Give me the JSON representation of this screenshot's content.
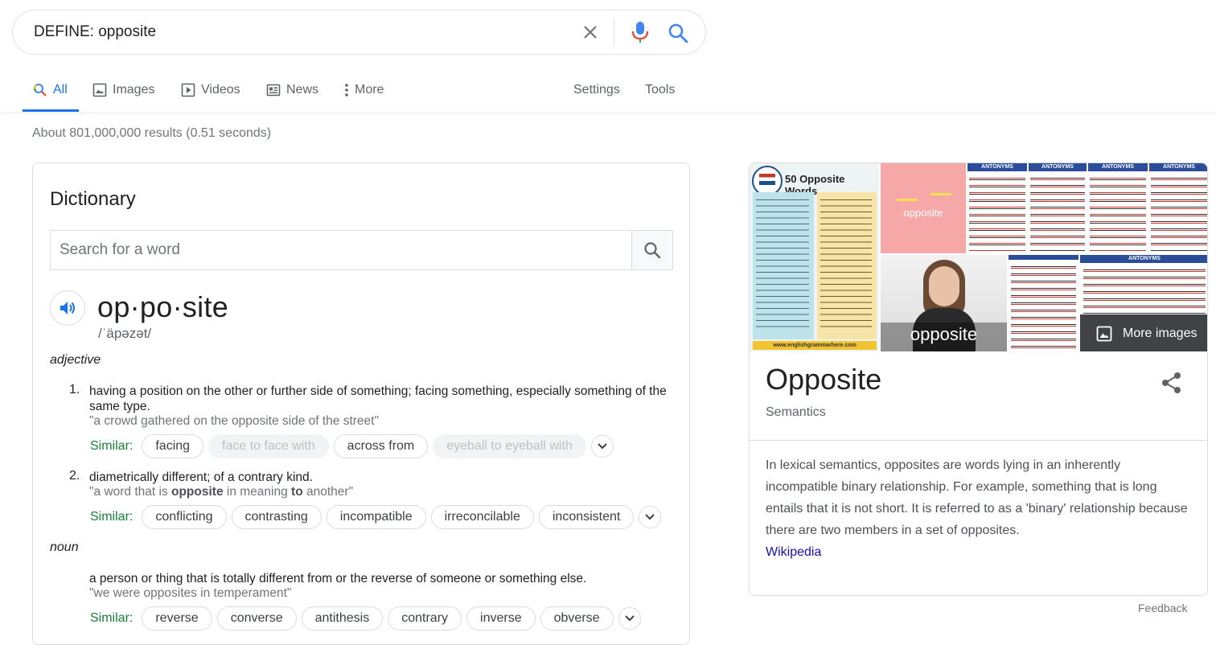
{
  "search": {
    "query": "DEFINE: opposite"
  },
  "tabs": [
    {
      "label": "All"
    },
    {
      "label": "Images"
    },
    {
      "label": "Videos"
    },
    {
      "label": "News"
    },
    {
      "label": "More"
    }
  ],
  "tools": {
    "settings": "Settings",
    "tools": "Tools"
  },
  "result_stats": "About 801,000,000 results (0.51 seconds)",
  "dictionary": {
    "title": "Dictionary",
    "search_placeholder": "Search for a word",
    "headword": "op·po·site",
    "phonetic": "/ˈäpəzət/",
    "similar_label": "Similar:",
    "pos_adjective": "adjective",
    "pos_noun": "noun",
    "senses": [
      {
        "number": "1.",
        "definition": "having a position on the other or further side of something; facing something, especially something of the same type.",
        "example": "\"a crowd gathered on the opposite side of the street\"",
        "similar": [
          "facing",
          "face to face with",
          "across from",
          "eyeball to eyeball with"
        ]
      },
      {
        "number": "2.",
        "definition": "diametrically different; of a contrary kind.",
        "example_parts": [
          "\"a word that is ",
          "opposite",
          " in meaning ",
          "to",
          " another\""
        ],
        "similar": [
          "conflicting",
          "contrasting",
          "incompatible",
          "irreconcilable",
          "inconsistent"
        ]
      },
      {
        "definition": "a person or thing that is totally different from or the reverse of someone or something else.",
        "example": "\"we were opposites in temperament\"",
        "similar": [
          "reverse",
          "converse",
          "antithesis",
          "contrary",
          "inverse",
          "obverse"
        ]
      }
    ]
  },
  "knowledge_panel": {
    "images": {
      "thumb1_title": "50 Opposite Words",
      "thumb1_footer": "www.englishgrammarhere.com",
      "thumb2_caption": "opposite",
      "thumb_antonyms": "ANTONYMS",
      "video_caption": "opposite",
      "more_images": "More images"
    },
    "title": "Opposite",
    "subtitle": "Semantics",
    "description": "In lexical semantics, opposites are words lying in an inherently incompatible binary relationship. For example, something that is long entails that it is not short. It is referred to as a 'binary' relationship because there are two members in a set of opposites.",
    "source_link": "Wikipedia"
  },
  "feedback": "Feedback",
  "colors": {
    "google_blue": "#1a73e8",
    "link": "#1a0dab",
    "similar_green": "#188038",
    "muted": "#70757a"
  }
}
